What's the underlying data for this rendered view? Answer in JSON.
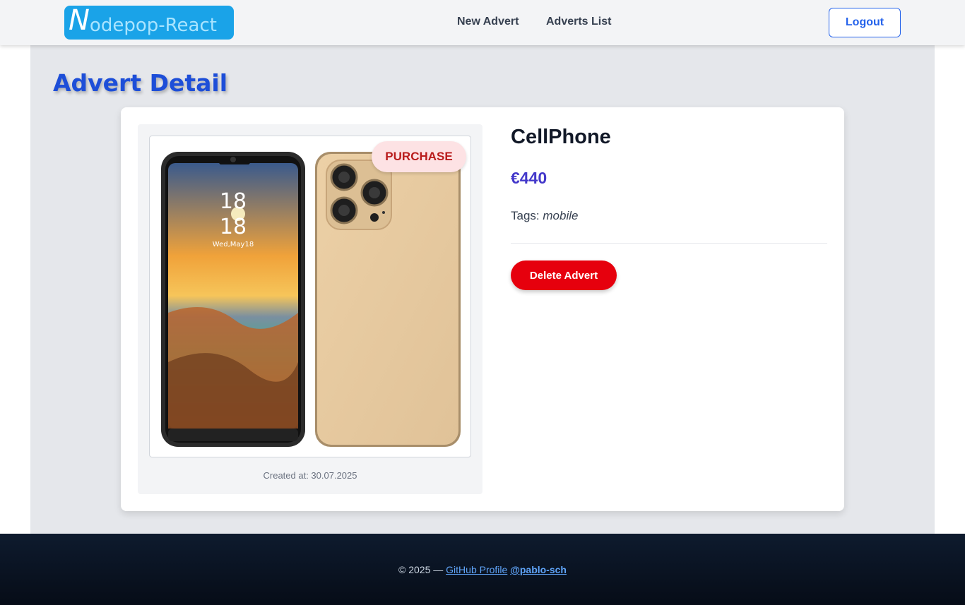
{
  "header": {
    "logo_initial": "N",
    "logo_rest": "odepop-React",
    "nav": {
      "new_advert": "New Advert",
      "adverts_list": "Adverts List"
    },
    "logout_label": "Logout"
  },
  "page": {
    "title": "Advert Detail"
  },
  "advert": {
    "badge": "PURCHASE",
    "name": "CellPhone",
    "price": "€440",
    "tags_label": "Tags:",
    "tags_value": "mobile",
    "created_at": "Created at: 30.07.2025",
    "phone_time_line1": "18",
    "phone_time_line2": "18",
    "phone_date": "Wed,May18",
    "delete_label": "Delete Advert"
  },
  "footer": {
    "prefix": "© 2025 —",
    "github_label": "GitHub Profile",
    "user_label": "@pablo-sch"
  },
  "colors": {
    "accent": "#2563eb",
    "title": "#1d4ed8",
    "price": "#4338ca",
    "danger": "#e6000d",
    "badge_bg": "#fde2e4",
    "badge_text": "#b91c1c"
  }
}
